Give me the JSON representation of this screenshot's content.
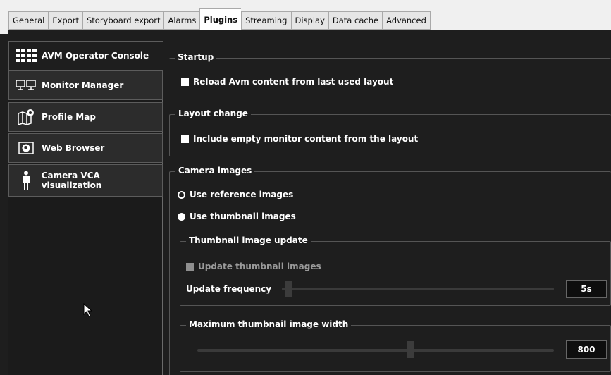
{
  "tabs": [
    {
      "label": "General"
    },
    {
      "label": "Export"
    },
    {
      "label": "Storyboard export"
    },
    {
      "label": "Alarms"
    },
    {
      "label": "Plugins",
      "active": true
    },
    {
      "label": "Streaming"
    },
    {
      "label": "Display"
    },
    {
      "label": "Data cache"
    },
    {
      "label": "Advanced"
    }
  ],
  "sidebar": {
    "items": [
      {
        "label": "AVM Operator Console",
        "icon": "grid-icon",
        "active": true
      },
      {
        "label": "Monitor Manager",
        "icon": "monitors-icon"
      },
      {
        "label": "Profile Map",
        "icon": "map-icon"
      },
      {
        "label": "Web Browser",
        "icon": "globe-icon"
      },
      {
        "label": "Camera VCA visualization",
        "icon": "person-icon"
      }
    ]
  },
  "startup": {
    "title": "Startup",
    "reload_label": "Reload Avm content from last used layout",
    "reload_checked": false
  },
  "layout_change": {
    "title": "Layout change",
    "include_empty_label": "Include empty monitor content from the layout",
    "include_empty_checked": false
  },
  "camera_images": {
    "title": "Camera images",
    "reference_label": "Use reference images",
    "thumbnail_label": "Use thumbnail images",
    "selected": "thumbnail",
    "thumbnail_update": {
      "title": "Thumbnail image update",
      "update_label": "Update thumbnail images",
      "update_enabled": false,
      "frequency_label": "Update frequency",
      "frequency_value": "5s"
    },
    "max_width": {
      "title": "Maximum thumbnail image width",
      "value": "800"
    }
  },
  "colors": {
    "background": "#1e1e1e",
    "tabbar": "#f0f0f0",
    "sidebar_item": "#2c2c2c",
    "text": "#ffffff",
    "disabled_text": "#9a9a9a"
  }
}
